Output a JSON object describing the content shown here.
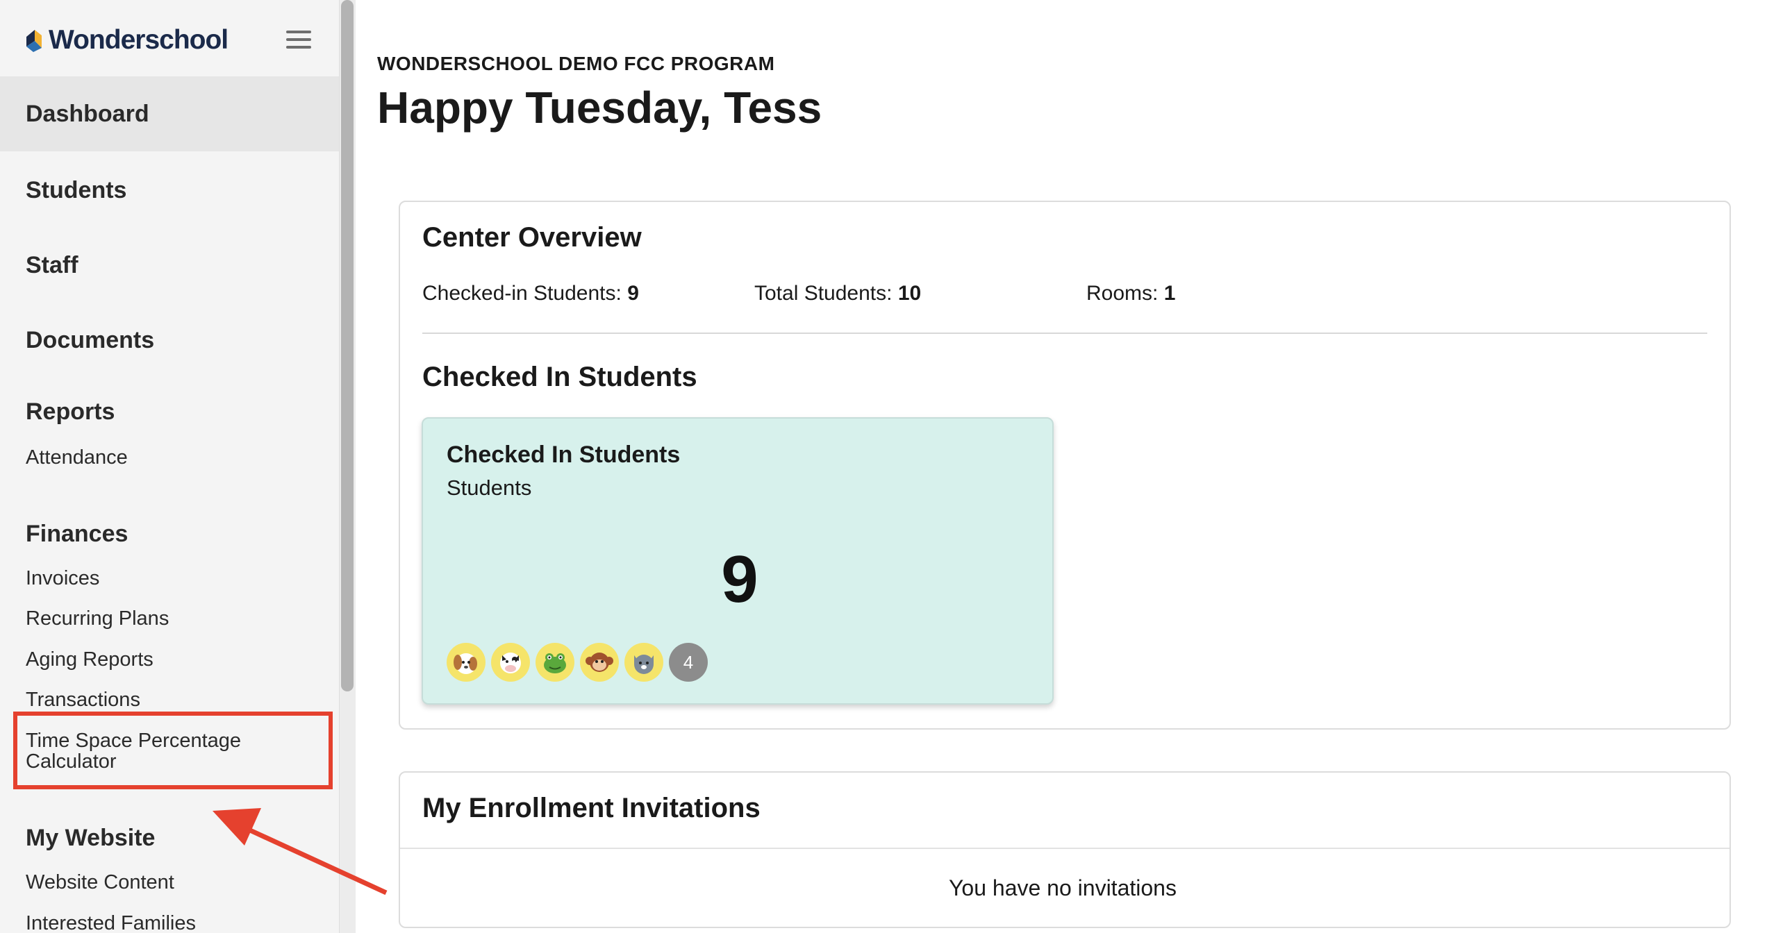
{
  "brand": {
    "name": "Wonderschool",
    "logo_icon": "wonderschool-logo-icon"
  },
  "sidebar": {
    "nav": [
      {
        "label": "Dashboard",
        "active": true
      },
      {
        "label": "Students"
      },
      {
        "label": "Staff"
      },
      {
        "label": "Documents"
      }
    ],
    "reports": {
      "heading": "Reports",
      "items": [
        "Attendance"
      ]
    },
    "finances": {
      "heading": "Finances",
      "items": [
        "Invoices",
        "Recurring Plans",
        "Aging Reports",
        "Transactions",
        "Time Space Percentage Calculator"
      ]
    },
    "website": {
      "heading": "My Website",
      "items": [
        "Website Content",
        "Interested Families"
      ]
    }
  },
  "header": {
    "program": "WONDERSCHOOL DEMO FCC PROGRAM",
    "greeting": "Happy Tuesday, Tess"
  },
  "overview": {
    "title": "Center Overview",
    "checked_in_label": "Checked-in Students:",
    "checked_in_value": "9",
    "total_label": "Total Students:",
    "total_value": "10",
    "rooms_label": "Rooms:",
    "rooms_value": "1"
  },
  "checked_in": {
    "section_title": "Checked In Students",
    "card_title": "Checked In Students",
    "card_subtitle": "Students",
    "count": "9",
    "avatars": [
      "dog-icon",
      "cow-icon",
      "frog-icon",
      "monkey-icon",
      "cat-icon"
    ],
    "more_count": "4"
  },
  "invitations": {
    "title": "My Enrollment Invitations",
    "empty_text": "You have no invitations"
  },
  "colors": {
    "highlight": "#e5412e",
    "card_bg": "#d7f1ec",
    "avatar_bg": "#f5e46a"
  }
}
